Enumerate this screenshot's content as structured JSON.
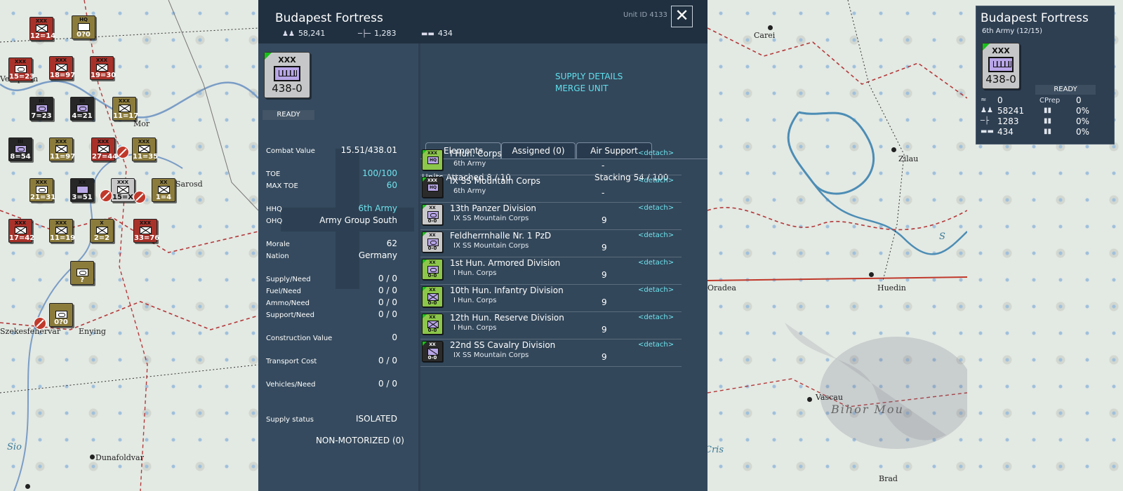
{
  "map_left": {
    "places": [
      {
        "name": "Sarosd"
      },
      {
        "name": "Szekesfehervar"
      },
      {
        "name": "Enying"
      },
      {
        "name": "Sio"
      },
      {
        "name": "Dunafoldvar"
      },
      {
        "name": "Veszprem"
      },
      {
        "name": "Mor"
      }
    ],
    "counters": [
      {
        "style": "red",
        "size": "XXX",
        "value": "12=14",
        "sym": "inf"
      },
      {
        "style": "olive",
        "size": "HQ",
        "value": "0?0",
        "sym": "hq"
      },
      {
        "style": "red",
        "size": "XXX",
        "value": "15=23",
        "sym": "arm"
      },
      {
        "style": "red",
        "size": "XXX",
        "value": "18=97",
        "sym": "inf"
      },
      {
        "style": "red",
        "size": "XXX",
        "value": "19=30",
        "sym": "inf"
      },
      {
        "style": "black",
        "size": "III",
        "value": "7=23",
        "sym": "arm"
      },
      {
        "style": "black",
        "size": "III",
        "value": "4=21",
        "sym": "arm"
      },
      {
        "style": "olive",
        "size": "XXX",
        "value": "11=17",
        "sym": "inf"
      },
      {
        "style": "black",
        "size": "III",
        "value": "8=54",
        "sym": "arm"
      },
      {
        "style": "olive",
        "size": "XXX",
        "value": "11=97",
        "sym": "inf"
      },
      {
        "style": "red",
        "size": "XXX",
        "value": "27=44",
        "sym": "inf"
      },
      {
        "style": "olive",
        "size": "XXX",
        "value": "11=35",
        "sym": "inf"
      },
      {
        "style": "olive",
        "size": "XXX",
        "value": "21=31",
        "sym": "arm"
      },
      {
        "style": "black",
        "size": "XX",
        "value": "3=51",
        "sym": "cav"
      },
      {
        "style": "gray",
        "size": "XXX",
        "value": "15=X",
        "sym": "inf"
      },
      {
        "style": "olive",
        "size": "XX",
        "value": "1=4",
        "sym": "inf"
      },
      {
        "style": "red",
        "size": "XXX",
        "value": "17=42",
        "sym": "inf"
      },
      {
        "style": "olive",
        "size": "XXX",
        "value": "11=19",
        "sym": "inf"
      },
      {
        "style": "olive",
        "size": "X",
        "value": "2=2",
        "sym": "inf"
      },
      {
        "style": "red",
        "size": "XXX",
        "value": "33=76",
        "sym": "inf"
      },
      {
        "style": "olive",
        "size": "",
        "value": "?",
        "sym": "arm"
      },
      {
        "style": "olive",
        "size": "",
        "value": "0?0",
        "sym": "arm"
      }
    ]
  },
  "panel": {
    "title": "Budapest Fortress",
    "unit_id": "Unit ID 4133",
    "men": "58,241",
    "guns": "1,283",
    "tanks": "434",
    "close_label": "✕",
    "counter": {
      "size": "XXX",
      "value": "438-0"
    },
    "ready_label": "READY",
    "stats": [
      {
        "label": "Combat Value",
        "value": "15.51/438.01",
        "cyan": false
      },
      {
        "label": "TOE",
        "value": "100/100",
        "cyan": true
      },
      {
        "label": "MAX TOE",
        "value": "60",
        "cyan": true
      },
      {
        "label": "HHQ",
        "value": "6th Army",
        "cyan": true
      },
      {
        "label": "OHQ",
        "value": "Army Group South",
        "cyan": false
      },
      {
        "label": "Morale",
        "value": "62",
        "cyan": false
      },
      {
        "label": "Nation",
        "value": "Germany",
        "cyan": false
      },
      {
        "label": "Supply/Need",
        "value": "0 / 0",
        "cyan": false
      },
      {
        "label": "Fuel/Need",
        "value": "0 / 0",
        "cyan": false
      },
      {
        "label": "Ammo/Need",
        "value": "0 / 0",
        "cyan": false
      },
      {
        "label": "Support/Need",
        "value": "0 / 0",
        "cyan": false
      },
      {
        "label": "Construction Value",
        "value": "0",
        "cyan": false
      },
      {
        "label": "Transport Cost",
        "value": "0 / 0",
        "cyan": false
      },
      {
        "label": "Vehicles/Need",
        "value": "0 / 0",
        "cyan": false
      },
      {
        "label": "Supply status",
        "value": "ISOLATED",
        "cyan": false
      }
    ],
    "motorization": "NON-MOTORIZED (0)",
    "links": {
      "supply": "SUPPLY DETAILS",
      "merge": "MERGE UNIT"
    },
    "tabs": [
      "Elements",
      "Assigned (0)",
      "Air Support"
    ],
    "units_attached": "Units Attached 8 / 10",
    "stacking": "Stacking 54 / 100",
    "detach_label": "<detach>",
    "elements": [
      {
        "name": "I Hun. Corps",
        "parent": "6th Army",
        "size": "-",
        "badge": "XXX",
        "val": "",
        "color": "green",
        "sym": "hq"
      },
      {
        "name": "IX SS Mountain Corps",
        "parent": "6th Army",
        "size": "-",
        "badge": "XXX",
        "val": "",
        "color": "black",
        "sym": "hq"
      },
      {
        "name": "13th Panzer Division",
        "parent": "IX SS Mountain Corps",
        "size": "9",
        "badge": "XX",
        "val": "0-0",
        "color": "gray",
        "sym": "arm"
      },
      {
        "name": "Feldherrnhalle Nr. 1 PzD",
        "parent": "IX SS Mountain Corps",
        "size": "9",
        "badge": "XX",
        "val": "0-0",
        "color": "gray",
        "sym": "arm"
      },
      {
        "name": "1st Hun. Armored Division",
        "parent": "I Hun. Corps",
        "size": "9",
        "badge": "XX",
        "val": "0-0",
        "color": "green",
        "sym": "arm"
      },
      {
        "name": "10th Hun. Infantry Division",
        "parent": "I Hun. Corps",
        "size": "9",
        "badge": "XX",
        "val": "0-0",
        "color": "green",
        "sym": "inf"
      },
      {
        "name": "12th Hun. Reserve Division",
        "parent": "I Hun. Corps",
        "size": "9",
        "badge": "XX",
        "val": "0-0",
        "color": "green",
        "sym": "inf"
      },
      {
        "name": "22nd SS Cavalry Division",
        "parent": "IX SS Mountain Corps",
        "size": "9",
        "badge": "XX",
        "val": "0-0",
        "color": "black",
        "sym": "cav"
      }
    ]
  },
  "map_right": {
    "places": [
      {
        "name": "Carei",
        "kind": "town"
      },
      {
        "name": "Zilau",
        "kind": "town"
      },
      {
        "name": "Oradea",
        "kind": "town"
      },
      {
        "name": "Huedin",
        "kind": "town"
      },
      {
        "name": "Vascau",
        "kind": "town"
      },
      {
        "name": "Bihor Mou",
        "kind": "region"
      },
      {
        "name": "Brad",
        "kind": "town"
      },
      {
        "name": "Cris",
        "kind": "water"
      },
      {
        "name": "S",
        "kind": "water"
      }
    ]
  },
  "summary": {
    "title": "Budapest Fortress",
    "subtitle": "6th Army (12/15)",
    "counter_size": "XXX",
    "counter_value": "438-0",
    "ready": "READY",
    "cprep_label": "CPrep",
    "fatigue": "0",
    "cprep": "0",
    "men": "58241",
    "guns": "1283",
    "tanks": "434",
    "pct1": "0%",
    "pct2": "0%",
    "pct3": "0%"
  },
  "colors": {
    "panel_bg": "#2e3f52",
    "link": "#5fe0ee",
    "cyan_value": "#6fe3ee",
    "ready_corner": "#16c21a"
  }
}
